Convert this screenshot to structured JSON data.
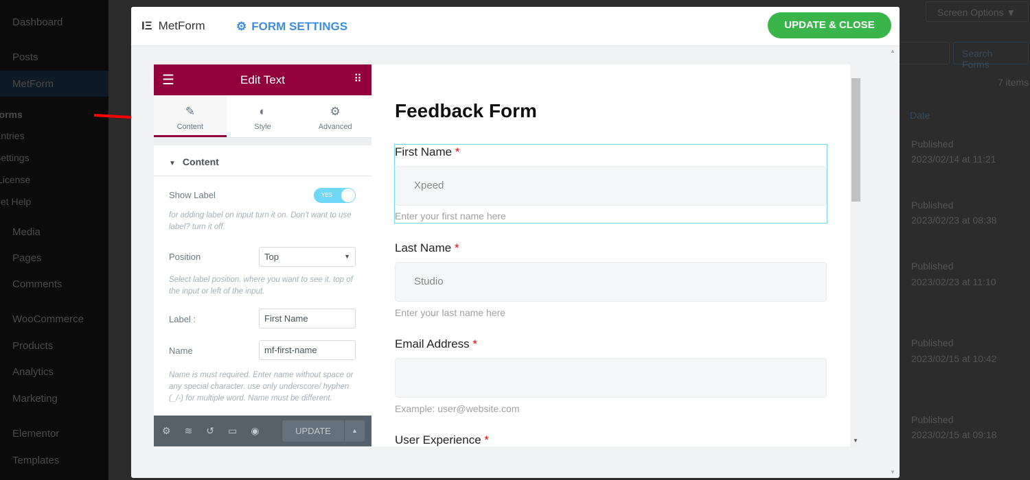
{
  "wp_sidebar": {
    "items": [
      "Dashboard",
      "Posts",
      "MetForm",
      "Media",
      "Pages",
      "Comments",
      "WooCommerce",
      "Products",
      "Analytics",
      "Marketing",
      "Elementor",
      "Templates"
    ],
    "submenu": [
      "Forms",
      "Entries",
      "Settings",
      "License",
      "Get Help"
    ]
  },
  "background": {
    "screen_options": "Screen Options ▼",
    "search_button": "Search Forms",
    "items_count": "7 items",
    "date_header": "Date",
    "rows": [
      {
        "status": "Published",
        "date": "2023/02/14 at 11:21"
      },
      {
        "status": "Published",
        "date": "2023/02/23 at 08:38"
      },
      {
        "status": "Published",
        "date": "2023/02/23 at 11:10"
      },
      {
        "status": "Published",
        "date": "2023/02/15 at 10:42"
      },
      {
        "status": "Published",
        "date": "2023/02/15 at 09:18"
      }
    ]
  },
  "modal": {
    "brand": "MetForm",
    "form_settings": "FORM SETTINGS",
    "update_close": "UPDATE & CLOSE",
    "accent": "#39b54a"
  },
  "panel": {
    "title": "Edit Text",
    "tabs": [
      {
        "label": "Content",
        "icon": "pencil-icon"
      },
      {
        "label": "Style",
        "icon": "contrast-icon"
      },
      {
        "label": "Advanced",
        "icon": "gear-icon"
      }
    ],
    "section": "Content",
    "show_label": {
      "label": "Show Label",
      "value": "YES",
      "help": "for adding label on input turn it on. Don't want to use label? turn it off."
    },
    "position": {
      "label": "Position",
      "value": "Top",
      "help": "Select label position. where you want to see it. top of the input or left of the input."
    },
    "label_field": {
      "label": "Label :",
      "value": "First Name"
    },
    "name_field": {
      "label": "Name",
      "value": "mf-first-name",
      "help": "Name is must required. Enter name without space or any special character. use only underscore/ hyphen (_/-) for multiple word. Name must be different."
    },
    "footer_update": "UPDATE",
    "color": "#93003c"
  },
  "form": {
    "title": "Feedback Form",
    "fields": [
      {
        "label": "First Name",
        "required": "*",
        "value": "Xpeed",
        "hint": "Enter your first name here"
      },
      {
        "label": "Last Name",
        "required": "*",
        "value": "Studio",
        "hint": "Enter your last name here"
      },
      {
        "label": "Email Address",
        "required": "*",
        "value": "",
        "hint": "Example: user@website.com"
      },
      {
        "label": "User Experience",
        "required": "*"
      }
    ]
  }
}
